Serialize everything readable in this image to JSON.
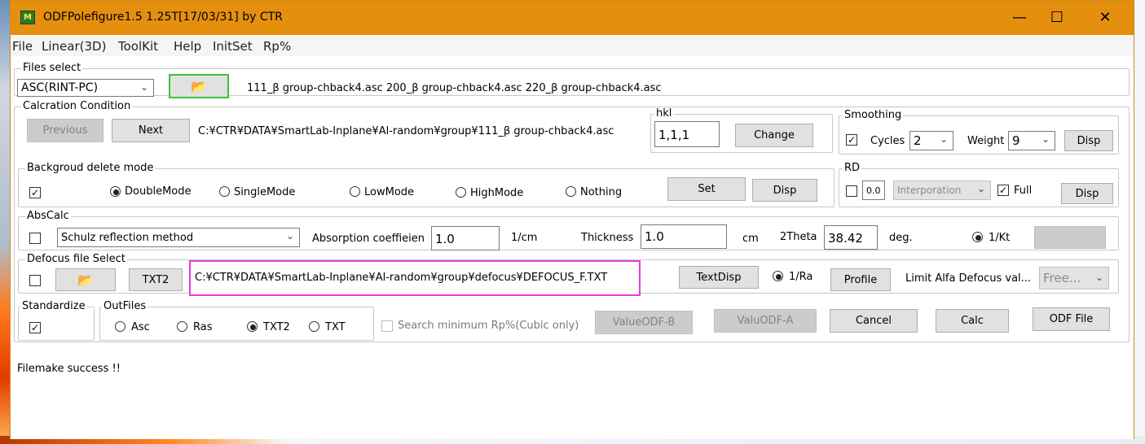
{
  "window": {
    "icon_glyph": "M",
    "title": "ODFPolefigure1.5 1.25T[17/03/31] by CTR",
    "minimize": "—",
    "maximize": "☐",
    "close": "✕"
  },
  "menu": [
    "File",
    "Linear(3D)",
    "ToolKit",
    "Help",
    "InitSet",
    "Rp%"
  ],
  "files_select": {
    "legend": "Files select",
    "format": "ASC(RINT-PC)",
    "open_icon": "folder-open-icon",
    "files": "111_β group-chback4.asc 200_β group-chback4.asc 220_β group-chback4.asc"
  },
  "calc_condition": {
    "legend": "Calcration Condition",
    "previous": "Previous",
    "next": "Next",
    "path": "C:¥CTR¥DATA¥SmartLab-Inplane¥Al-random¥group¥111_β group-chback4.asc"
  },
  "hkl": {
    "legend": "hkl",
    "value": "1,1,1",
    "change": "Change"
  },
  "smoothing": {
    "legend": "Smoothing",
    "cycles_label": "Cycles",
    "cycles_value": "2",
    "weight_label": "Weight",
    "weight_value": "9",
    "disp": "Disp"
  },
  "background": {
    "legend": "Backgroud delete mode",
    "modes": [
      "DoubleMode",
      "SingleMode",
      "LowMode",
      "HighMode",
      "Nothing"
    ],
    "selected": "DoubleMode",
    "set": "Set",
    "disp": "Disp"
  },
  "rd": {
    "legend": "RD",
    "value": "0.0",
    "mode": "Interporation",
    "full_label": "Full",
    "disp": "Disp"
  },
  "abscalc": {
    "legend": "AbsCalc",
    "method": "Schulz reflection method",
    "absorption_label": "Absorption coeffieien",
    "absorption_value": "1.0",
    "absorption_unit": "1/cm",
    "thickness_label": "Thickness",
    "thickness_value": "1.0",
    "thickness_unit": "cm",
    "twotheta_label": "2Theta",
    "twotheta_value": "38.42",
    "twotheta_unit": "deg.",
    "kt_label": "1/Kt"
  },
  "defocus": {
    "legend": "Defocus file Select",
    "txt2": "TXT2",
    "path": "C:¥CTR¥DATA¥SmartLab-Inplane¥Al-random¥group¥defocus¥DEFOCUS_F.TXT",
    "textdisp": "TextDisp",
    "ra_label": "1/Ra",
    "profile": "Profile",
    "limit_label": "Limit Alfa Defocus val...",
    "limit_value": "Free..."
  },
  "standardize": {
    "legend": "Standardize"
  },
  "outfiles": {
    "legend": "OutFiles",
    "options": [
      "Asc",
      "Ras",
      "TXT2",
      "TXT"
    ],
    "selected": "TXT2"
  },
  "actions": {
    "search_label": "Search minimum Rp%(Cubic only)",
    "value_odf_b": "ValueODF-B",
    "valu_odf_a": "ValuODF-A",
    "cancel": "Cancel",
    "calc": "Calc",
    "odf_file": "ODF File"
  },
  "status": "Filemake success !!",
  "colors": {
    "titlebar": "#e58f0e",
    "highlight_green": "#39c43f",
    "highlight_magenta": "#e63be0"
  }
}
